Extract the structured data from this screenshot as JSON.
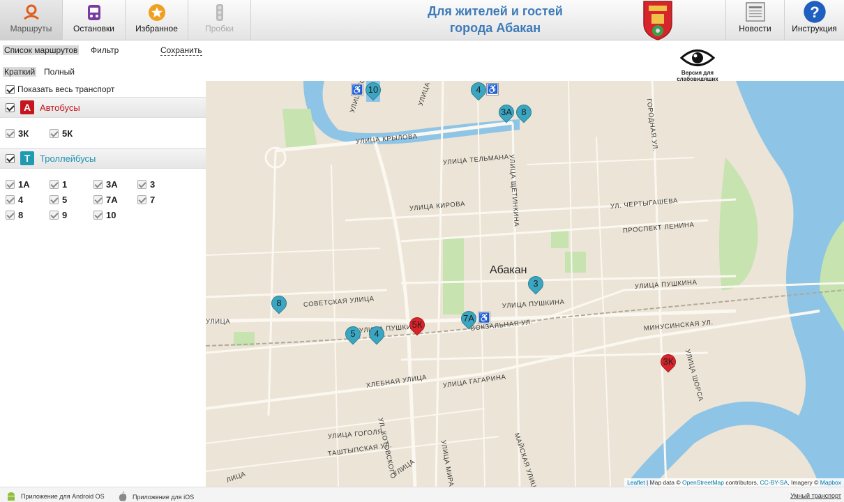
{
  "header": {
    "tabs": [
      {
        "label": "Маршруты",
        "icon": "route-pin-icon"
      },
      {
        "label": "Остановки",
        "icon": "bus-stop-icon"
      },
      {
        "label": "Избранное",
        "icon": "star-icon"
      },
      {
        "label": "Пробки",
        "icon": "traffic-light-icon"
      }
    ],
    "title_line1": "Для жителей и гостей",
    "title_line2": "города Абакан",
    "right_tabs": [
      {
        "label": "Новости",
        "icon": "news-icon"
      },
      {
        "label": "Инструкция",
        "icon": "help-icon"
      }
    ]
  },
  "panel": {
    "links": [
      "Список маршрутов",
      "Фильтр",
      "Сохранить"
    ],
    "modes": [
      "Краткий",
      "Полный"
    ],
    "show_all": "Показать весь транспорт",
    "groups": [
      {
        "letter": "А",
        "name": "Автобусы",
        "color": "#c4161c",
        "routes": [
          "3К",
          "5К"
        ]
      },
      {
        "letter": "Т",
        "name": "Троллейбусы",
        "color": "#1e9bb0",
        "routes": [
          "1А",
          "1",
          "3А",
          "3",
          "4",
          "5",
          "7А",
          "7",
          "8",
          "9",
          "10"
        ]
      }
    ]
  },
  "accessibility": {
    "line1": "Версия для",
    "line2": "слабовидящих"
  },
  "map": {
    "city": "Абакан",
    "streets": [
      "УЛИЦА ТОР",
      "УЛИЦА КАТИ",
      "УЛИЦА КРЫЛОВА",
      "УЛИЦА ТЕЛЬМАНА",
      "УЛИЦА ЩЕТИНКИНА",
      "УЛИЦА КИРОВА",
      "УЛ. ЧЕРТЫГАШЕВА",
      "ПРОСПЕКТ ЛЕНИНА",
      "УЛИЦА ПУШКИНА",
      "УЛИЦА ПУШКИНА",
      "СОВЕТСКАЯ УЛИЦА",
      "УЛИЦА",
      "УЛИЦА ПУШКИНА",
      "ВОКЗАЛЬНАЯ УЛ.",
      "МИНУСИНСКАЯ УЛ.",
      "УЛИЦА ШОРСА",
      "ХЛЕБНАЯ УЛИЦА",
      "УЛИЦА ГАГАРИНА",
      "УЛ. КОТОВСКОГО",
      "УЛИЦА ГОГОЛЯ",
      "ТАШТЫПСКАЯ УЛ.",
      "МАЙСКАЯ УЛИЦА",
      "УЛИЦА МИРА",
      "ГОРОДНАЯ УЛ.",
      "ЛИЦА",
      "УЛИЦА"
    ],
    "markers": [
      {
        "label": "10",
        "kind": "trolley",
        "accessible": true
      },
      {
        "label": "4",
        "kind": "trolley",
        "accessible": true
      },
      {
        "label": "3А",
        "kind": "trolley",
        "accessible": false
      },
      {
        "label": "8",
        "kind": "trolley",
        "accessible": false
      },
      {
        "label": "3",
        "kind": "trolley",
        "accessible": false
      },
      {
        "label": "8",
        "kind": "trolley",
        "accessible": false
      },
      {
        "label": "7А",
        "kind": "trolley",
        "accessible": true
      },
      {
        "label": "5",
        "kind": "trolley",
        "accessible": false
      },
      {
        "label": "4",
        "kind": "trolley",
        "accessible": false
      },
      {
        "label": "5К",
        "kind": "bus",
        "accessible": false
      },
      {
        "label": "3К",
        "kind": "bus",
        "accessible": false
      }
    ],
    "colors": {
      "trolley": "#3aa6c2",
      "bus": "#d8232a",
      "water": "#8ec4e6",
      "park": "#b9dea0"
    },
    "attribution": {
      "leaflet": "Leaflet",
      "sep1": " | Map data © ",
      "osm": "OpenStreetMap",
      "mid": " contributors, ",
      "cc": "CC-BY-SA",
      "mid2": ", Imagery © ",
      "mapbox": "Mapbox"
    }
  },
  "footer": {
    "android": "Приложение для Android OS",
    "ios": "Приложение для iOS",
    "right": "Умный транспорт"
  }
}
